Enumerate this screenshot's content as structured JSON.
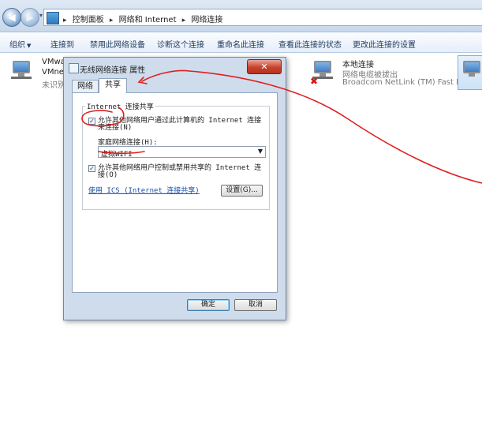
{
  "address": {
    "crumbs": [
      "控制面板",
      "网络和 Internet",
      "网络连接"
    ]
  },
  "toolbar": {
    "organize": "组织",
    "connect_to": "连接到",
    "disable": "禁用此网络设备",
    "diagnose": "诊断这个连接",
    "rename": "重命名此连接",
    "status": "查看此连接的状态",
    "change": "更改此连接的设置"
  },
  "connections": [
    {
      "name": "VMwa",
      "line2": "VMne",
      "line3": "未识别"
    },
    {
      "name": "本地连接",
      "line2": "网络电缆被拔出",
      "line3": "Broadcom NetLink (TM) Fast E..."
    }
  ],
  "dialog": {
    "title": "无线网络连接 属性",
    "close": "✕",
    "tabs": [
      "网络",
      "共享"
    ],
    "group_label": "Internet 连接共享",
    "allow_sharing_line1": "允许其他网络用户通过此计算机的 Internet 连接",
    "allow_sharing_line2": "来连接(N)",
    "home_network_label": "家庭网络连接(H):",
    "home_network_value": "虚拟WIFI",
    "allow_control_line1": "允许其他网络用户控制或禁用共享的 Internet 连",
    "allow_control_line2": "接(O)",
    "ics_link": "使用 ICS (Internet 连接共享)",
    "settings_button": "设置(G)...",
    "ok_button": "确定",
    "cancel_button": "取消"
  },
  "colors": {
    "annotation_red": "#e11f1f",
    "link_blue": "#1a4fa3"
  }
}
